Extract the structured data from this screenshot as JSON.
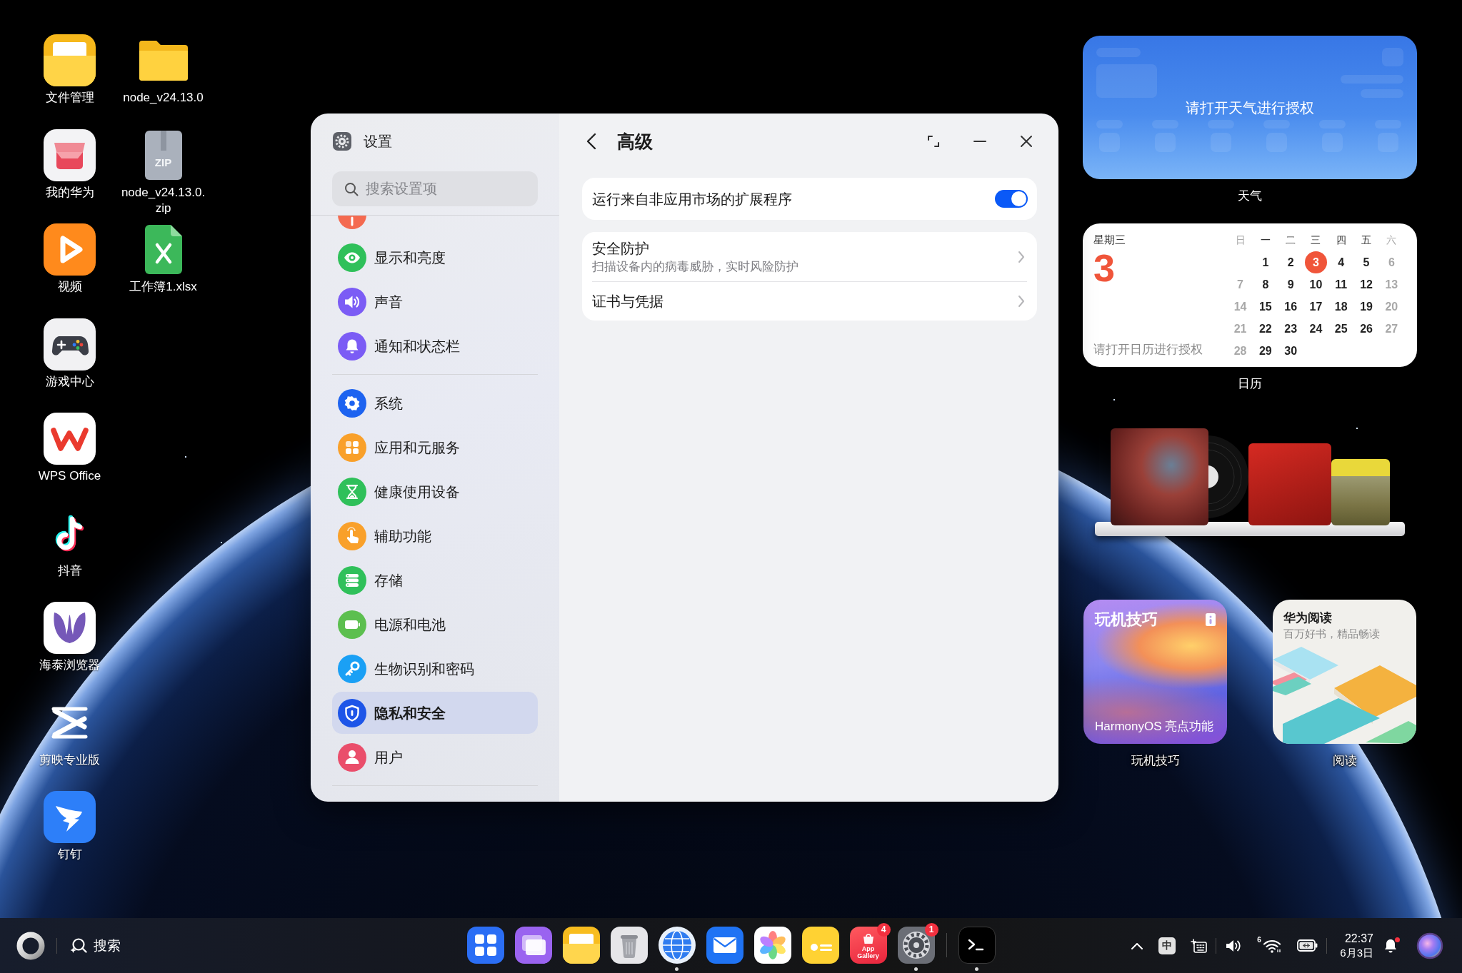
{
  "desktop_icons": [
    {
      "label": "文件管理",
      "kind": "file-manager"
    },
    {
      "label": "我的华为",
      "kind": "my-huawei"
    },
    {
      "label": "视频",
      "kind": "video"
    },
    {
      "label": "游戏中心",
      "kind": "game-center"
    },
    {
      "label": "WPS Office",
      "kind": "wps"
    },
    {
      "label": "抖音",
      "kind": "douyin"
    },
    {
      "label": "海泰浏览器",
      "kind": "haitai-browser"
    },
    {
      "label": "剪映专业版",
      "kind": "capcut"
    },
    {
      "label": "钉钉",
      "kind": "dingtalk"
    },
    {
      "label": "node_v24.13.0",
      "kind": "folder"
    },
    {
      "label": "node_v24.13.0.zip",
      "kind": "zip",
      "icon_text": "ZIP"
    },
    {
      "label": "工作簿1.xlsx",
      "kind": "spreadsheet"
    }
  ],
  "settings_window": {
    "sidebar": {
      "title": "设置",
      "search": {
        "placeholder": "搜索设置项"
      },
      "groups": [
        {
          "items": [
            {
              "kind": "personalize",
              "selected": false
            },
            {
              "kind": "display",
              "label": "显示和亮度",
              "selected": false
            },
            {
              "kind": "sound",
              "label": "声音",
              "selected": false
            },
            {
              "kind": "notifications",
              "label": "通知和状态栏",
              "selected": false
            }
          ]
        },
        {
          "items": [
            {
              "kind": "system",
              "label": "系统",
              "selected": false
            },
            {
              "kind": "apps",
              "label": "应用和元服务",
              "selected": false
            },
            {
              "kind": "health",
              "label": "健康使用设备",
              "selected": false
            },
            {
              "kind": "accessibility",
              "label": "辅助功能",
              "selected": false
            },
            {
              "kind": "storage",
              "label": "存储",
              "selected": false
            },
            {
              "kind": "power",
              "label": "电源和电池",
              "selected": false
            },
            {
              "kind": "biometrics",
              "label": "生物识别和密码",
              "selected": false
            },
            {
              "kind": "privacy",
              "label": "隐私和安全",
              "selected": true
            },
            {
              "kind": "users",
              "label": "用户",
              "selected": false
            }
          ]
        }
      ]
    },
    "content": {
      "title": "高级",
      "cards": [
        {
          "rows": [
            {
              "kind": "toggle",
              "label": "运行来自非应用市场的扩展程序",
              "on": true
            }
          ]
        },
        {
          "rows": [
            {
              "kind": "link",
              "label": "安全防护",
              "description": "扫描设备内的病毒威胁，实时风险防护"
            },
            {
              "kind": "link",
              "label": "证书与凭据"
            }
          ]
        }
      ]
    }
  },
  "widgets": {
    "weather": {
      "message": "请打开天气进行授权",
      "label": "天气"
    },
    "calendar": {
      "weekday": "星期三",
      "day": "3",
      "message": "请打开日历进行授权",
      "headers": [
        "日",
        "一",
        "二",
        "三",
        "四",
        "五",
        "六"
      ],
      "weeks": [
        [
          {
            "day": "1",
            "selected": false
          },
          {
            "day": "2",
            "selected": false
          },
          {
            "day": "3",
            "selected": true
          },
          {
            "day": "4",
            "selected": false
          },
          {
            "day": "5",
            "selected": false
          },
          {
            "day": "6",
            "selected": false
          }
        ],
        [
          {
            "day": "7",
            "selected": false
          },
          {
            "day": "8",
            "selected": false
          },
          {
            "day": "9",
            "selected": false
          },
          {
            "day": "10",
            "selected": false
          },
          {
            "day": "11",
            "selected": false
          },
          {
            "day": "12",
            "selected": false
          },
          {
            "day": "13",
            "selected": false
          }
        ],
        [
          {
            "day": "14",
            "selected": false
          },
          {
            "day": "15",
            "selected": false
          },
          {
            "day": "16",
            "selected": false
          },
          {
            "day": "17",
            "selected": false
          },
          {
            "day": "18",
            "selected": false
          },
          {
            "day": "19",
            "selected": false
          },
          {
            "day": "20",
            "selected": false
          }
        ],
        [
          {
            "day": "21",
            "selected": false
          },
          {
            "day": "22",
            "selected": false
          },
          {
            "day": "23",
            "selected": false
          },
          {
            "day": "24",
            "selected": false
          },
          {
            "day": "25",
            "selected": false
          },
          {
            "day": "26",
            "selected": false
          },
          {
            "day": "27",
            "selected": false
          }
        ],
        [
          {
            "day": "28",
            "selected": false
          },
          {
            "day": "29",
            "selected": false
          },
          {
            "day": "30",
            "selected": false
          }
        ]
      ],
      "label": "日历"
    },
    "music": {
      "shelf": [
        {
          "kind": "nebula-cover"
        },
        {
          "kind": "vinyl-record"
        },
        {
          "kind": "portrait-cover"
        },
        {
          "kind": "painting-cover"
        }
      ]
    },
    "tips": {
      "title": "玩机技巧",
      "caption": "HarmonyOS 亮点功能",
      "label": "玩机技巧"
    },
    "reading": {
      "title": "华为阅读",
      "subtitle": "百万好书，精品畅读",
      "label": "阅读"
    }
  },
  "taskbar": {
    "search_label": "搜索",
    "dock_groups": [
      {
        "apps": [
          {
            "kind": "launcher",
            "running": false
          },
          {
            "kind": "multi-window",
            "running": false
          },
          {
            "kind": "files",
            "running": false
          },
          {
            "kind": "trash",
            "running": false
          },
          {
            "kind": "browser",
            "running": true
          },
          {
            "kind": "mail",
            "running": false
          },
          {
            "kind": "photos",
            "running": false
          },
          {
            "kind": "notes",
            "running": false
          },
          {
            "kind": "app-gallery",
            "text": "App Gallery",
            "badge": "4",
            "running": false
          },
          {
            "kind": "settings",
            "badge": "1",
            "running": true
          }
        ]
      },
      {
        "apps": [
          {
            "kind": "terminal",
            "running": true
          }
        ]
      }
    ],
    "tray_groups": [
      {
        "items": [
          {
            "kind": "chevron-up"
          },
          {
            "kind": "input-method",
            "text": "中"
          },
          {
            "kind": "input-panel"
          }
        ]
      },
      {
        "items": [
          {
            "kind": "volume"
          },
          {
            "kind": "wifi",
            "standard": "6"
          },
          {
            "kind": "battery"
          }
        ]
      }
    ],
    "clock": {
      "time": "22:37",
      "date": "6月3日"
    },
    "notifications": {
      "unread": true
    }
  }
}
